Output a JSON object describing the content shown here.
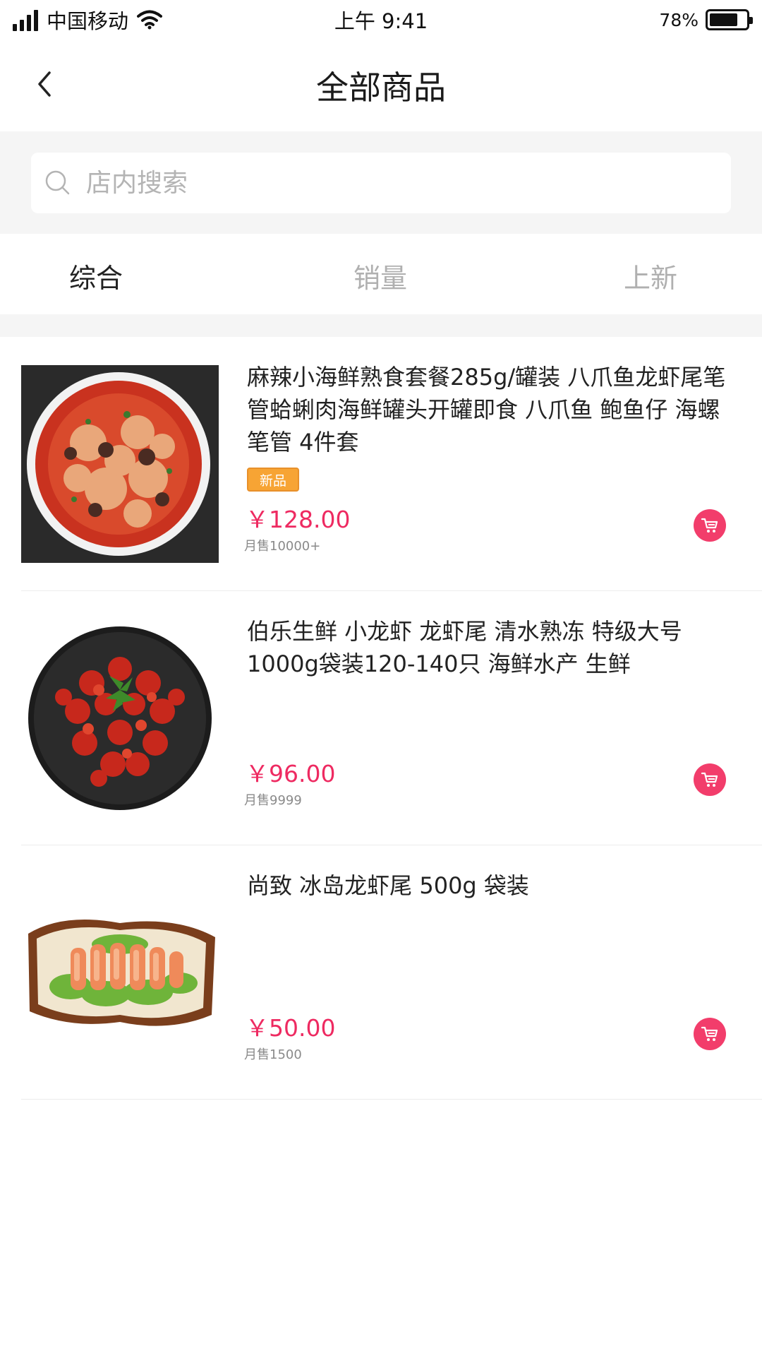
{
  "status_bar": {
    "carrier": "中国移动",
    "time": "上午 9:41",
    "battery": "78%",
    "battery_level": 0.78
  },
  "nav": {
    "title": "全部商品",
    "back_icon": "chevron-left-icon"
  },
  "search": {
    "placeholder": "店内搜索",
    "icon": "search-icon"
  },
  "tabs": [
    {
      "label": "综合",
      "active": true
    },
    {
      "label": "销量",
      "active": false
    },
    {
      "label": "上新",
      "active": false
    }
  ],
  "products": [
    {
      "title": "麻辣小海鲜熟食套餐285g/罐装 八爪鱼龙虾尾笔管蛤蜊肉海鲜罐头开罐即食 八爪鱼 鲍鱼仔 海螺笔管 4件套",
      "badge": "新品",
      "price": "￥128.00",
      "sales": "月售10000+"
    },
    {
      "title": "伯乐生鲜 小龙虾 龙虾尾 清水熟冻 特级大号 1000g袋装120-140只 海鲜水产 生鲜",
      "badge": "",
      "price": "￥96.00",
      "sales": "月售9999"
    },
    {
      "title": "尚致 冰岛龙虾尾 500g 袋装",
      "badge": "",
      "price": "￥50.00",
      "sales": "月售1500"
    }
  ],
  "colors": {
    "accent": "#ee2a61",
    "cart": "#f23d6b",
    "badge": "#f7a434",
    "background_gray": "#f5f5f5"
  }
}
